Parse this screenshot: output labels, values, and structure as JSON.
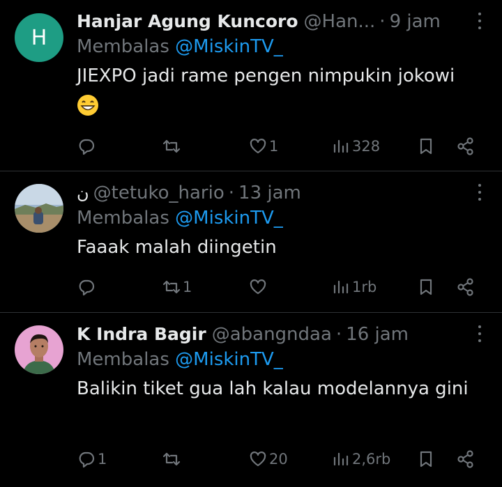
{
  "tweets": [
    {
      "avatar_letter": "H",
      "avatar_color": "#1e9d84",
      "display_name": "Hanjar Agung Kuncoro",
      "handle": "@Han...",
      "separator": "·",
      "time": "9 jam",
      "reply_prefix": "Membalas",
      "reply_to": "@MiskinTV_",
      "text": "JIEXPO jadi rame pengen nimpukin jokowi",
      "emoji": "grinning-face-emoji",
      "replies": "",
      "retweets": "",
      "likes": "1",
      "views": "328"
    },
    {
      "avatar_icon": "landscape-photo",
      "name_prefix": "ن",
      "handle": "@tetuko_hario",
      "separator": "·",
      "time": "13 jam",
      "reply_prefix": "Membalas",
      "reply_to": "@MiskinTV_",
      "text": "Faaak malah diingetin",
      "replies": "",
      "retweets": "1",
      "likes": "",
      "views": "1rb"
    },
    {
      "avatar_icon": "person-photo",
      "display_name": "K Indra Bagir",
      "handle": "@abangndaa",
      "separator": "·",
      "time": "16 jam",
      "reply_prefix": "Membalas",
      "reply_to": "@MiskinTV_",
      "text": "Balikin tiket gua lah kalau modelannya gini",
      "replies": "1",
      "retweets": "",
      "likes": "20",
      "views": "2,6rb"
    }
  ],
  "colors": {
    "background": "#000000",
    "text": "#e7e9ea",
    "muted": "#71767b",
    "mention": "#1d9bf0",
    "divider": "#2f3336"
  }
}
